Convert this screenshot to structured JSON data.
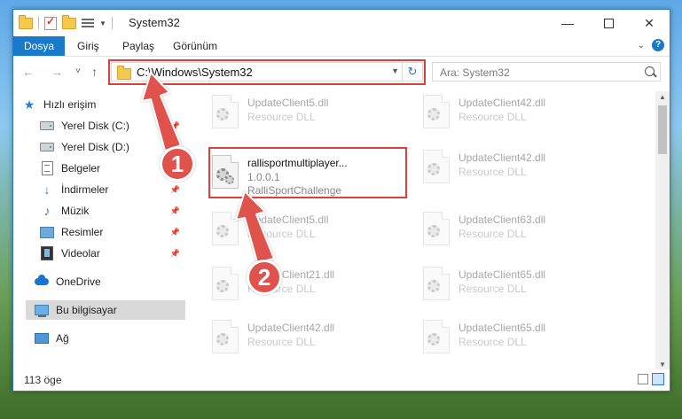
{
  "window": {
    "title": "System32",
    "minimize_glyph": "—",
    "close_glyph": "✕"
  },
  "ribbon": {
    "tabs": [
      "Dosya",
      "Giriş",
      "Paylaş",
      "Görünüm"
    ],
    "active_tab": "Dosya",
    "help_glyph": "?"
  },
  "nav": {
    "back_glyph": "←",
    "forward_glyph": "→",
    "recent_glyph": "˅",
    "up_glyph": "↑"
  },
  "address": {
    "path": "C:\\Windows\\System32",
    "refresh_glyph": "↻"
  },
  "search": {
    "placeholder": "Ara: System32"
  },
  "navpane": {
    "items": [
      {
        "label": "Hızlı erişim",
        "icon": "star-icon"
      },
      {
        "label": "Yerel Disk (C:)",
        "icon": "drive-icon",
        "pinned": true
      },
      {
        "label": "Yerel Disk (D:)",
        "icon": "drive-icon"
      },
      {
        "label": "Belgeler",
        "icon": "documents-icon"
      },
      {
        "label": "İndirmeler",
        "icon": "download-icon",
        "pinned": true
      },
      {
        "label": "Müzik",
        "icon": "music-icon",
        "pinned": true
      },
      {
        "label": "Resimler",
        "icon": "pictures-icon",
        "pinned": true
      },
      {
        "label": "Videolar",
        "icon": "video-icon",
        "pinned": true
      },
      {
        "label": "OneDrive",
        "icon": "onedrive-icon"
      },
      {
        "label": "Bu bilgisayar",
        "icon": "computer-icon",
        "selected": true
      },
      {
        "label": "Ağ",
        "icon": "network-icon"
      }
    ]
  },
  "files": {
    "left_column": [
      {
        "name": "UpdateClient5.dll",
        "desc": "Resource DLL"
      },
      {
        "name": "rallisportmultiplayer...",
        "version": "1.0.0.1",
        "desc": "RalliSportChallenge"
      },
      {
        "name": "UpdateClient5.dll",
        "desc": "Resource DLL"
      },
      {
        "name": "UpdateClient21.dll",
        "desc": "Resource DLL"
      },
      {
        "name": "UpdateClient42.dll",
        "desc": "Resource DLL"
      }
    ],
    "right_column": [
      {
        "name": "UpdateClient42.dll",
        "desc": "Resource DLL"
      },
      {
        "name": "UpdateClient42.dll",
        "desc": "Resource DLL"
      },
      {
        "name": "UpdateClient63.dll",
        "desc": "Resource DLL"
      },
      {
        "name": "UpdateClient65.dll",
        "desc": "Resource DLL"
      },
      {
        "name": "UpdateClient65.dll",
        "desc": "Resource DLL"
      }
    ]
  },
  "status": {
    "item_count": "113 öge"
  },
  "annotations": {
    "step1": "1",
    "step2": "2",
    "color": "#e0524d"
  },
  "colors": {
    "accent": "#1979ca",
    "highlight": "#d9403b"
  }
}
